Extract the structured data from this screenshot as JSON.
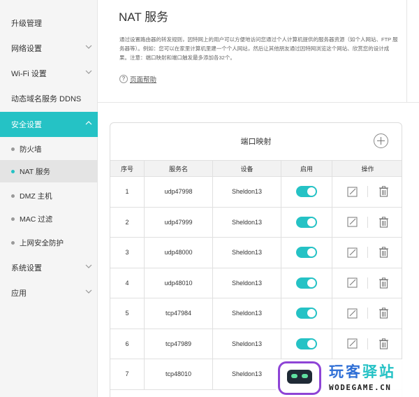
{
  "sidebar": {
    "items": [
      {
        "label": "升级管理",
        "expandable": false
      },
      {
        "label": "网络设置",
        "expandable": true
      },
      {
        "label": "Wi-Fi 设置",
        "expandable": true
      },
      {
        "label": "动态域名服务 DDNS",
        "expandable": false
      },
      {
        "label": "安全设置",
        "expandable": true,
        "active": true
      },
      {
        "label": "系统设置",
        "expandable": true
      },
      {
        "label": "应用",
        "expandable": true
      }
    ],
    "subitems": [
      {
        "label": "防火墙"
      },
      {
        "label": "NAT 服务",
        "active": true
      },
      {
        "label": "DMZ 主机"
      },
      {
        "label": "MAC 过滤"
      },
      {
        "label": "上网安全防护"
      }
    ]
  },
  "page": {
    "title": "NAT 服务",
    "description": "通过设置路由器的转发规则，因特网上的用户可以方便地访问您通过个人计算机提供的服务器资源（如个人网站、FTP 服务器等）。例如：您可以在家里计算机里建一个个人网站，然后让其他朋友通过因特网浏览这个网站、欣赏您的设计成果。注意：端口映射和端口触发最多添加各32个。",
    "help_label": "页面帮助",
    "help_icon": "?"
  },
  "port_mapping": {
    "title": "端口映射",
    "columns": [
      "序号",
      "服务名",
      "设备",
      "启用",
      "操作"
    ],
    "rows": [
      {
        "index": "1",
        "service": "udp47998",
        "device": "Sheldon13",
        "enabled": true
      },
      {
        "index": "2",
        "service": "udp47999",
        "device": "Sheldon13",
        "enabled": true
      },
      {
        "index": "3",
        "service": "udp48000",
        "device": "Sheldon13",
        "enabled": true
      },
      {
        "index": "4",
        "service": "udp48010",
        "device": "Sheldon13",
        "enabled": true
      },
      {
        "index": "5",
        "service": "tcp47984",
        "device": "Sheldon13",
        "enabled": true
      },
      {
        "index": "6",
        "service": "tcp47989",
        "device": "Sheldon13",
        "enabled": true
      },
      {
        "index": "7",
        "service": "tcp48010",
        "device": "Sheldon13",
        "enabled": true
      }
    ]
  },
  "watermark": {
    "name_part1": "玩客",
    "name_part2": "驿站",
    "url": "WODEGAME.CN"
  },
  "colors": {
    "accent": "#25c2c5",
    "sidebar_bg": "#f5f5f5",
    "watermark_purple": "#8e44d6",
    "watermark_blue": "#2f6fd6"
  }
}
